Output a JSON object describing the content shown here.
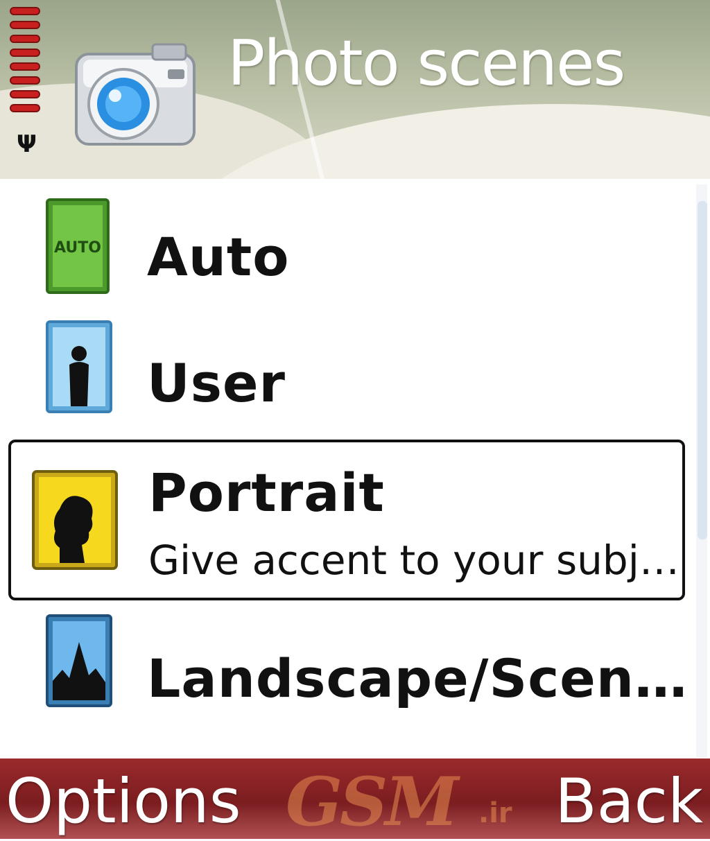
{
  "header": {
    "title": "Photo scenes",
    "icon": "camera-icon",
    "signal_icon": "signal-strength-icon",
    "signal_bars": 8
  },
  "list": {
    "items": [
      {
        "label": "Auto",
        "icon": "auto-scene-icon",
        "icon_text": "AUTO",
        "selected": false
      },
      {
        "label": "User",
        "icon": "user-scene-icon",
        "selected": false
      },
      {
        "label": "Portrait",
        "description": "Give accent to your subj…",
        "icon": "portrait-scene-icon",
        "selected": true
      },
      {
        "label": "Landscape/Scen…",
        "icon": "landscape-scene-icon",
        "selected": false
      }
    ]
  },
  "softkeys": {
    "left": "Options",
    "right": "Back"
  },
  "watermark": {
    "main": "GSM",
    "suffix": ".ir"
  },
  "colors": {
    "softbar": "#7b1d20",
    "selection_border": "#111111",
    "auto_icon": "#5fb53a",
    "user_icon": "#8ec9ee",
    "portrait_icon": "#f1d21c",
    "landscape_icon": "#5aa6e6"
  }
}
